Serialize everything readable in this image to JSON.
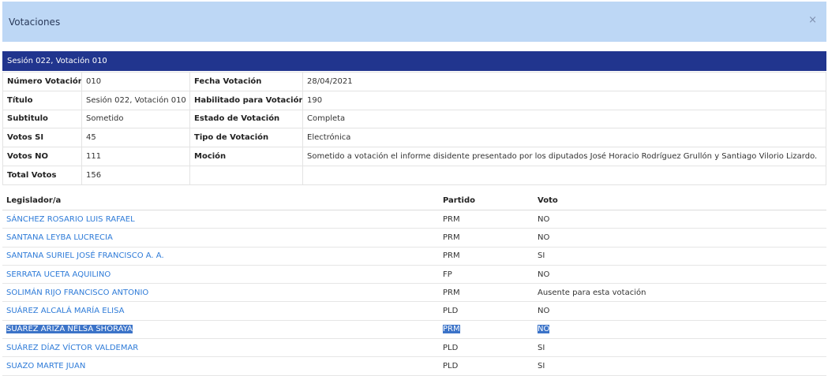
{
  "modal": {
    "title": "Votaciones",
    "close_glyph": "×"
  },
  "session_header": "Sesión 022, Votación 010",
  "info": {
    "numero_votacion": {
      "label": "Número Votación",
      "value": "010"
    },
    "fecha_votacion": {
      "label": "Fecha Votación",
      "value": "28/04/2021"
    },
    "titulo": {
      "label": "Título",
      "value": "Sesión 022, Votación 010"
    },
    "habilitado": {
      "label": "Habilitado para Votación",
      "value": "190"
    },
    "subtitulo": {
      "label": "Subtitulo",
      "value": "Sometido"
    },
    "estado": {
      "label": "Estado de Votación",
      "value": "Completa"
    },
    "votos_si": {
      "label": "Votos SI",
      "value": "45"
    },
    "tipo": {
      "label": "Tipo de Votación",
      "value": "Electrónica"
    },
    "votos_no": {
      "label": "Votos NO",
      "value": "111"
    },
    "mocion": {
      "label": "Moción",
      "value": "Sometido a votación el informe disidente presentado por los diputados José Horacio Rodríguez Grullón y Santiago Vilorio Lizardo."
    },
    "total_votos": {
      "label": "Total Votos",
      "value": "156"
    }
  },
  "votes_table": {
    "headers": {
      "legislador": "Legislador/a",
      "partido": "Partido",
      "voto": "Voto"
    },
    "rows": [
      {
        "legislador": "SÁNCHEZ ROSARIO LUIS RAFAEL",
        "partido": "PRM",
        "voto": "NO"
      },
      {
        "legislador": "SANTANA LEYBA LUCRECIA",
        "partido": "PRM",
        "voto": "NO"
      },
      {
        "legislador": "SANTANA SURIEL JOSÉ FRANCISCO A. A.",
        "partido": "PRM",
        "voto": "SI"
      },
      {
        "legislador": "SERRATA UCETA AQUILINO",
        "partido": "FP",
        "voto": "NO"
      },
      {
        "legislador": "SOLIMÁN RIJO FRANCISCO ANTONIO",
        "partido": "PRM",
        "voto": "Ausente para esta votación"
      },
      {
        "legislador": "SUÁREZ ALCALÁ MARÍA ELISA",
        "partido": "PLD",
        "voto": "NO"
      },
      {
        "legislador": "SUÁREZ ARIZA NELSA SHORAYA",
        "partido": "PRM",
        "voto": "NO"
      },
      {
        "legislador": "SUÁREZ DÍAZ VÍCTOR VALDEMAR",
        "partido": "PLD",
        "voto": "SI"
      },
      {
        "legislador": "SUAZO MARTE JUAN",
        "partido": "PLD",
        "voto": "SI"
      }
    ]
  }
}
